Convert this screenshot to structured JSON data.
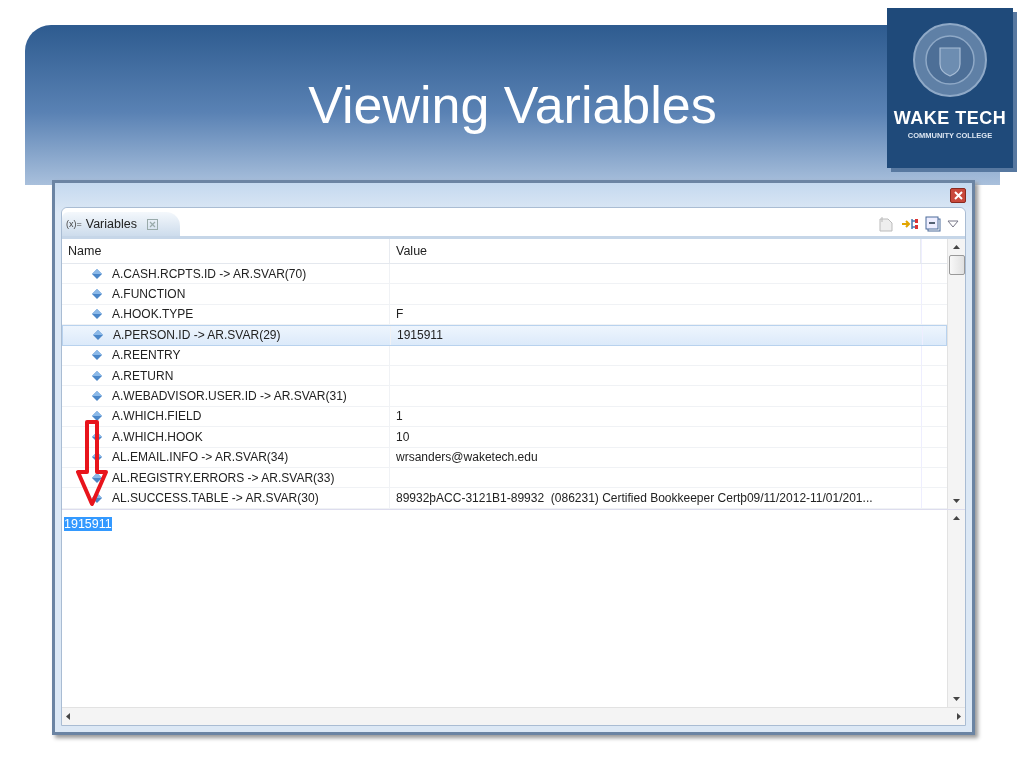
{
  "slide": {
    "title": "Viewing Variables",
    "logo": {
      "name": "WAKE TECH",
      "subtitle": "COMMUNITY COLLEGE"
    }
  },
  "view": {
    "tab": {
      "icon_label": "(x)=",
      "label": "Variables",
      "selected": true
    },
    "columns": [
      "Name",
      "Value"
    ],
    "rows": [
      {
        "name": "A.CASH.RCPTS.ID -> AR.SVAR(70)",
        "value": "",
        "selected": false
      },
      {
        "name": "A.FUNCTION",
        "value": "",
        "selected": false
      },
      {
        "name": "A.HOOK.TYPE",
        "value": "F",
        "selected": false
      },
      {
        "name": "A.PERSON.ID -> AR.SVAR(29)",
        "value": "1915911",
        "selected": true
      },
      {
        "name": "A.REENTRY",
        "value": "",
        "selected": false
      },
      {
        "name": "A.RETURN",
        "value": "",
        "selected": false
      },
      {
        "name": "A.WEBADVISOR.USER.ID -> AR.SVAR(31)",
        "value": "",
        "selected": false
      },
      {
        "name": "A.WHICH.FIELD",
        "value": "1",
        "selected": false
      },
      {
        "name": "A.WHICH.HOOK",
        "value": "10",
        "selected": false
      },
      {
        "name": "AL.EMAIL.INFO -> AR.SVAR(34)",
        "value": "wrsanders@waketech.edu",
        "selected": false
      },
      {
        "name": "AL.REGISTRY.ERRORS -> AR.SVAR(33)",
        "value": "",
        "selected": false
      },
      {
        "name": "AL.SUCCESS.TABLE -> AR.SVAR(30)",
        "value": "89932þACC-3121B1-89932  (086231) Certified Bookkeeper Certþ09/11/2012-11/01/201...",
        "selected": false
      }
    ],
    "detail": {
      "text": "1915911",
      "selected": true
    }
  }
}
